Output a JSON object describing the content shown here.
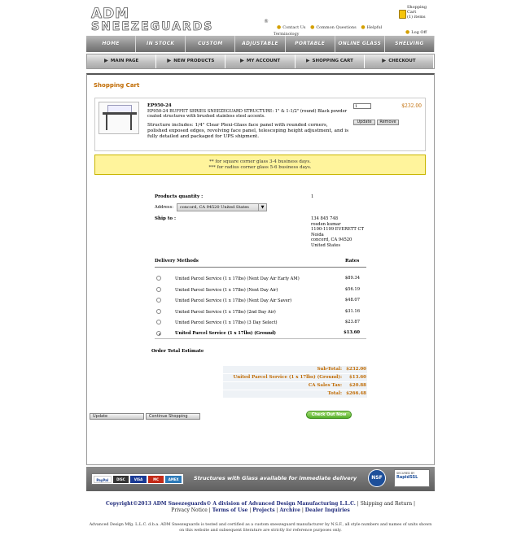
{
  "header": {
    "logo_text": "ADM SNEEZEGUARDS",
    "links": [
      "Contact Us",
      "Common Questions",
      "Helpful Terminology"
    ],
    "cart": {
      "label": "Shopping Cart",
      "count": "(1) items"
    },
    "logout": "Log Off"
  },
  "nav_primary": [
    "HOME",
    "IN STOCK",
    "CUSTOM",
    "ADJUSTABLE",
    "PORTABLE",
    "ONLINE GLASS",
    "SHELVING"
  ],
  "nav_secondary": [
    "MAIN PAGE",
    "NEW PRODUCTS",
    "MY ACCOUNT",
    "SHOPPING CART",
    "CHECKOUT"
  ],
  "page_title": "Shopping Cart",
  "product": {
    "code": "EP950-24",
    "line1": "EP950-24 BUFFET SERIES SNEEZEGUARD STRUCTURE: 1\" & 1-1/2\" (round) Black powder coated structures with brushed stainless steel accents.",
    "line2": "Structure includes: 1/4\" Clear Plexi-Glass face panel with rounded corners, polished exposed edges, revolving face panel, telescoping height adjustment, and is fully detailed and packaged for UPS shipment.",
    "quantity": "1",
    "price": "$232.00",
    "update_label": "Update",
    "remove_label": "Remove"
  },
  "notice": [
    "** for square corner glass 3-4 business days.",
    "*** for radius corner glass 5-6 business days."
  ],
  "summary": {
    "qty_label": "Products quantity :",
    "qty_value": "1",
    "address_label": "Address:",
    "address_selected": "concord, CA 94520 United States",
    "shipto_label": "Ship to :",
    "shipto_lines": [
      "134 845 748",
      "rosden kumar",
      "1100-1199 EVERETT CT",
      "Noida",
      "concord, CA 94520",
      "United States"
    ]
  },
  "delivery": {
    "header_methods": "Delivery Methods",
    "header_rates": "Rates",
    "options": [
      {
        "name": "United Parcel Service (1 x 17lbs) (Next Day Air Early AM)",
        "rate": "$89.34",
        "selected": false
      },
      {
        "name": "United Parcel Service (1 x 17lbs) (Next Day Air)",
        "rate": "$56.19",
        "selected": false
      },
      {
        "name": "United Parcel Service (1 x 17lbs) (Next Day Air Saver)",
        "rate": "$48.07",
        "selected": false
      },
      {
        "name": "United Parcel Service (1 x 17lbs) (2nd Day Air)",
        "rate": "$31.16",
        "selected": false
      },
      {
        "name": "United Parcel Service (1 x 17lbs) (3 Day Select)",
        "rate": "$23.87",
        "selected": false
      },
      {
        "name": "United Parcel Service (1 x 17lbs) (Ground)",
        "rate": "$13.60",
        "selected": true
      }
    ]
  },
  "estimate": {
    "title": "Order Total Estimate",
    "rows": [
      {
        "label": "Sub-Total:",
        "value": "$232.00"
      },
      {
        "label": "United Parcel Service (1 x 17lbs) (Ground):",
        "value": "$13.60"
      },
      {
        "label": "CA Sales Tax:",
        "value": "$20.88"
      },
      {
        "label": "Total:",
        "value": "$266.48"
      }
    ]
  },
  "actions": {
    "update": "Update",
    "continue": "Continue Shopping",
    "checkout": "Check Out Now"
  },
  "footer": {
    "payments": [
      "PayPal",
      "DISC",
      "VISA",
      "MC",
      "AMEX"
    ],
    "slogan": "Structures with Glass available for immediate delivery",
    "nsf": "NSF",
    "ssl_top": "SECURED BY",
    "ssl_brand": "RapidSSL",
    "copyright": "Copyright©2013 ADM Sneezeguards© A division of Advanced Design Manufacturing L.L.C.",
    "links": [
      "Shipping and Return",
      "Privacy Notice",
      "Terms of Use",
      "Projects",
      "Archive",
      "Dealer Inquiries"
    ],
    "legal": "Advanced Design Mfg. L.L.C. d.b.a. ADM Sneezeguards is tested and certified as a custom sneezeguard manufacturer by N.S.F., all style numbers and names of units shown on this website and subsequent literature are strictly for reference purposes only."
  },
  "colors": {
    "accent": "#c06a00",
    "notice_bg": "#fff49c",
    "nav_gray": "#8c8c8c"
  }
}
